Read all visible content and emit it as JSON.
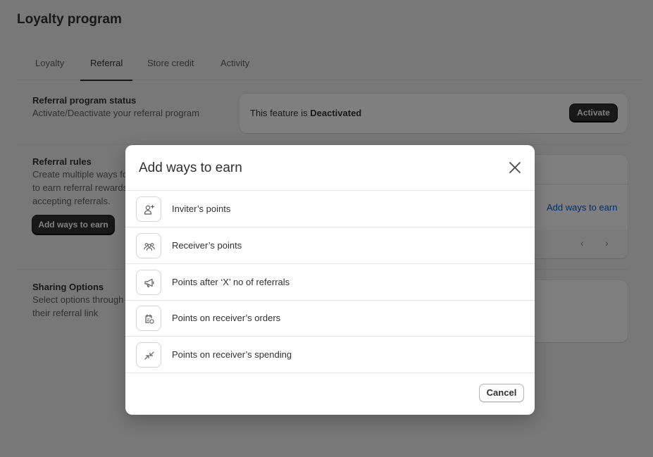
{
  "page": {
    "title": "Loyalty program",
    "tabs": [
      {
        "label": "Loyalty"
      },
      {
        "label": "Referral"
      },
      {
        "label": "Store credit"
      },
      {
        "label": "Activity"
      }
    ],
    "active_tab": "Referral"
  },
  "status_section": {
    "title": "Referral program status",
    "description": "Activate/Deactivate your referral program",
    "status_prefix": "This feature is ",
    "status_value": "Deactivated",
    "activate_label": "Activate"
  },
  "rules_section": {
    "title": "Referral rules",
    "description_lines": [
      "Create multiple ways fo",
      "to earn referral rewards",
      "accepting referrals."
    ],
    "add_ways_button_label": "Add ways to earn",
    "add_ways_link_label": "Add ways to earn"
  },
  "sharing_section": {
    "title": "Sharing Options",
    "description_lines": [
      "Select options through",
      "their referral link"
    ]
  },
  "modal": {
    "title": "Add ways to earn",
    "options": [
      {
        "label": "Inviter’s points",
        "icon": "person-add-icon"
      },
      {
        "label": "Receiver’s points",
        "icon": "people-icon"
      },
      {
        "label": "Points after ‘X’ no of referrals",
        "icon": "megaphone-icon"
      },
      {
        "label": "Points on receiver’s orders",
        "icon": "order-icon"
      },
      {
        "label": "Points on receiver’s spending",
        "icon": "arrows-icon"
      }
    ],
    "cancel_label": "Cancel"
  }
}
